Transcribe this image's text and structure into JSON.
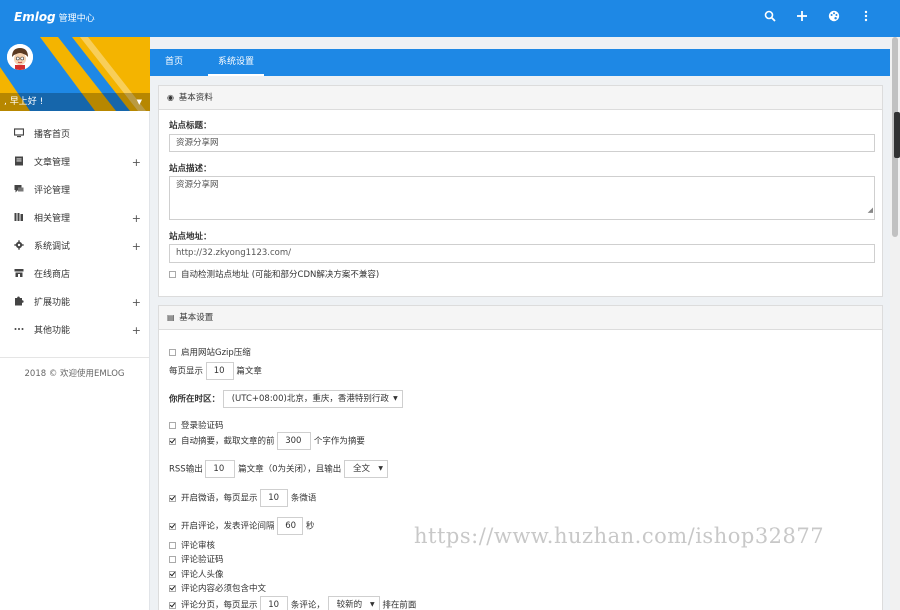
{
  "header": {
    "logo": "Emlog",
    "subtitle": "管理中心",
    "icons": [
      "search-icon",
      "plus-icon",
      "palette-icon",
      "more-vertical-icon"
    ]
  },
  "sidebar": {
    "greeting": ", 早上好 !",
    "items": [
      {
        "label": "播客首页",
        "icon": "monitor-icon",
        "expandable": false
      },
      {
        "label": "文章管理",
        "icon": "article-icon",
        "expandable": true
      },
      {
        "label": "评论管理",
        "icon": "comment-icon",
        "expandable": false
      },
      {
        "label": "相关管理",
        "icon": "library-icon",
        "expandable": true
      },
      {
        "label": "系统调试",
        "icon": "gear-icon",
        "expandable": true
      },
      {
        "label": "在线商店",
        "icon": "store-icon",
        "expandable": false
      },
      {
        "label": "扩展功能",
        "icon": "extension-icon",
        "expandable": true
      },
      {
        "label": "其他功能",
        "icon": "ellipsis-icon",
        "expandable": true
      }
    ],
    "footer": "2018 © 欢迎使用EMLOG",
    "plus_glyph": "+"
  },
  "tabs": [
    {
      "label": "首页",
      "active": false
    },
    {
      "label": "系统设置",
      "active": true
    }
  ],
  "basic_info": {
    "title": "基本资料",
    "site_title_label": "站点标题：",
    "site_title_value": "资源分享网",
    "site_desc_label": "站点描述：",
    "site_desc_value": "资源分享网",
    "site_url_label": "站点地址：",
    "site_url_value": "http://32.zkyong1123.com/",
    "auto_detect_label": "自动检测站点地址 (可能和部分CDN解决方案不兼容)",
    "auto_detect_checked": false
  },
  "basic_settings": {
    "title": "基本设置",
    "gzip_label": "启用网站Gzip压缩",
    "gzip_checked": false,
    "per_page_prefix": "每页显示",
    "per_page_value": "10",
    "per_page_suffix": "篇文章",
    "timezone_label": "你所在时区：",
    "timezone_value": "(UTC+08:00)北京，重庆，香港特别行政",
    "login_captcha_label": "登录验证码",
    "login_captcha_checked": false,
    "auto_summary_label": "自动摘要，截取文章的前",
    "auto_summary_checked": true,
    "summary_length_value": "300",
    "summary_suffix": "个字作为摘要",
    "rss_prefix": "RSS输出",
    "rss_count_value": "10",
    "rss_middle": "篇文章（0为关闭），且输出",
    "rss_mode_value": "全文",
    "twitter_label": "开启微语，每页显示",
    "twitter_checked": true,
    "twitter_count_value": "10",
    "twitter_suffix": "条微语",
    "comment_label": "开启评论，发表评论间隔",
    "comment_checked": true,
    "comment_interval_value": "60",
    "comment_suffix": "秒",
    "comment_review_label": "评论审核",
    "comment_review_checked": false,
    "comment_captcha_label": "评论验证码",
    "comment_captcha_checked": false,
    "comment_avatar_label": "评论人头像",
    "comment_avatar_checked": true,
    "comment_chinese_label": "评论内容必须包含中文",
    "comment_chinese_checked": true,
    "comment_paging_label": "评论分页，每页显示",
    "comment_paging_checked": true,
    "comment_paging_value": "10",
    "comment_paging_middle": "条评论，",
    "comment_order_value": "较新的",
    "comment_order_suffix": "排在前面"
  },
  "watermark": "https://www.huzhan.com/ishop32877",
  "colors": {
    "primary": "#1e88e5",
    "banner_yellow": "#f4b400"
  }
}
